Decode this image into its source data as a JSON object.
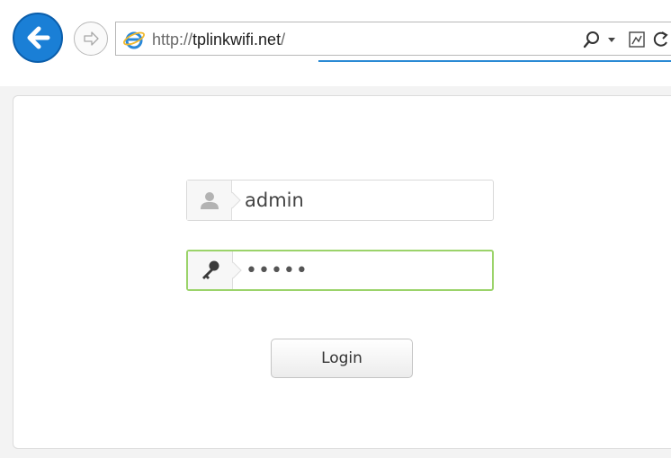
{
  "browser": {
    "address": {
      "url_prefix": "http://",
      "url_host": "tplinkwifi.net",
      "url_suffix": "/"
    },
    "icons": {
      "back": "back-arrow-icon",
      "forward": "forward-arrow-icon",
      "site": "internet-explorer-icon",
      "search": "search-icon",
      "dropdown": "chevron-down-icon",
      "compatibility": "compatibility-view-icon",
      "refresh": "refresh-icon"
    },
    "colors": {
      "back_button": "#1a7fd6",
      "loading_line": "#2a8ad4"
    }
  },
  "login": {
    "username": {
      "icon": "user-icon",
      "value": "admin"
    },
    "password": {
      "icon": "key-icon",
      "value": "•••••",
      "focused": true
    },
    "button_label": "Login",
    "colors": {
      "focus_border": "#9bd36a"
    }
  }
}
